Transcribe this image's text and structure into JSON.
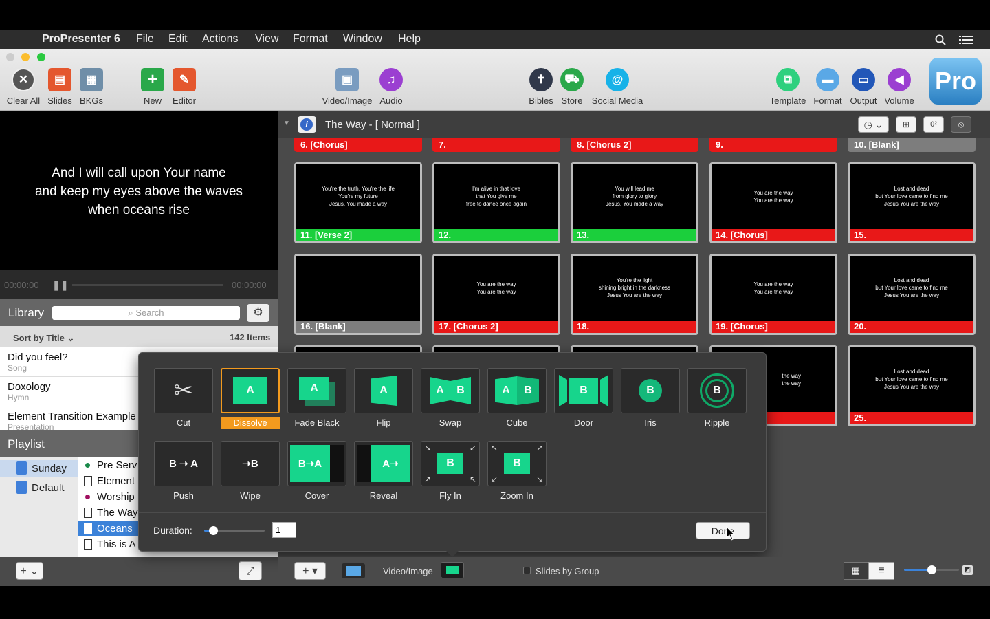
{
  "menubar": {
    "apple": "",
    "app_name": "ProPresenter 6",
    "items": [
      "File",
      "Edit",
      "Actions",
      "View",
      "Format",
      "Window",
      "Help"
    ]
  },
  "toolbar": {
    "clear_all": "Clear All",
    "slides": "Slides",
    "bkgs": "BKGs",
    "new": "New",
    "editor": "Editor",
    "video_image": "Video/Image",
    "audio": "Audio",
    "bibles": "Bibles",
    "store": "Store",
    "social_media": "Social Media",
    "template": "Template",
    "format": "Format",
    "output": "Output",
    "volume": "Volume",
    "logo": "Pro"
  },
  "preview": {
    "lines": [
      "And I will call upon Your name",
      "and keep my eyes above the waves",
      "when oceans rise"
    ],
    "time_start": "00:00:00",
    "time_end": "00:00:00"
  },
  "library": {
    "title": "Library",
    "search_placeholder": "Search",
    "sort_label": "Sort by Title",
    "count": "142 Items",
    "items": [
      {
        "title": "Did you feel?",
        "sub": "Song"
      },
      {
        "title": "Doxology",
        "sub": "Hymn"
      },
      {
        "title": "Element Transition Example",
        "sub": "Presentation"
      }
    ]
  },
  "playlist": {
    "title": "Playlist",
    "folders": [
      "Sunday",
      "Default"
    ],
    "items": [
      "Pre Serv",
      "Element",
      "Worship",
      "The Way",
      "Oceans",
      "This is A"
    ]
  },
  "document": {
    "title": "The Way - [ Normal ]"
  },
  "top_row": [
    {
      "label": "6. [Chorus]",
      "color": "red"
    },
    {
      "label": "7.",
      "color": "red"
    },
    {
      "label": "8. [Chorus 2]",
      "color": "red"
    },
    {
      "label": "9.",
      "color": "red"
    },
    {
      "label": "10. [Blank]",
      "color": "gray"
    }
  ],
  "slides": [
    {
      "label": "11. [Verse 2]",
      "color": "green",
      "text": [
        "You're the truth, You're the life",
        "You're my future",
        "Jesus, You made a way"
      ]
    },
    {
      "label": "12.",
      "color": "green",
      "text": [
        "I'm alive in that love",
        "that You give me",
        "free to dance once again"
      ]
    },
    {
      "label": "13.",
      "color": "green",
      "text": [
        "You will lead me",
        "from glory to glory",
        "Jesus, You made a way"
      ]
    },
    {
      "label": "14. [Chorus]",
      "color": "red",
      "text": [
        "You are the way",
        "You are the way"
      ]
    },
    {
      "label": "15.",
      "color": "red",
      "text": [
        "Lost and dead",
        "but Your love came to find me",
        "Jesus You are the way"
      ]
    },
    {
      "label": "16. [Blank]",
      "color": "gray",
      "text": []
    },
    {
      "label": "17. [Chorus 2]",
      "color": "red",
      "text": [
        "You are the way",
        "You are the way"
      ]
    },
    {
      "label": "18.",
      "color": "red",
      "text": [
        "You're the light",
        "shining bright in the darkness",
        "Jesus You are the way"
      ]
    },
    {
      "label": "19. [Chorus]",
      "color": "red",
      "text": [
        "You are the way",
        "You are the way"
      ]
    },
    {
      "label": "20.",
      "color": "red",
      "text": [
        "Lost and dead",
        "but Your love came to find me",
        "Jesus You are the way"
      ]
    },
    {
      "label": "s]",
      "color": "red",
      "text": [
        "the way",
        "the way"
      ]
    },
    {
      "label": "25.",
      "color": "red",
      "text": [
        "Lost and dead",
        "but Your love came to find me",
        "Jesus You are the way"
      ]
    }
  ],
  "transitions": {
    "row1": [
      "Cut",
      "Dissolve",
      "Fade Black",
      "Flip",
      "Swap",
      "Cube",
      "Door",
      "Iris",
      "Ripple"
    ],
    "row2": [
      "Push",
      "Wipe",
      "Cover",
      "Reveal",
      "Fly In",
      "Zoom In"
    ],
    "selected": "Dissolve",
    "duration_label": "Duration:",
    "duration_value": "1",
    "duration_level": 0.15,
    "done": "Done"
  },
  "bottombar": {
    "video_image": "Video/Image",
    "slides_by_group": "Slides by Group",
    "zoom_level": 0.5
  }
}
